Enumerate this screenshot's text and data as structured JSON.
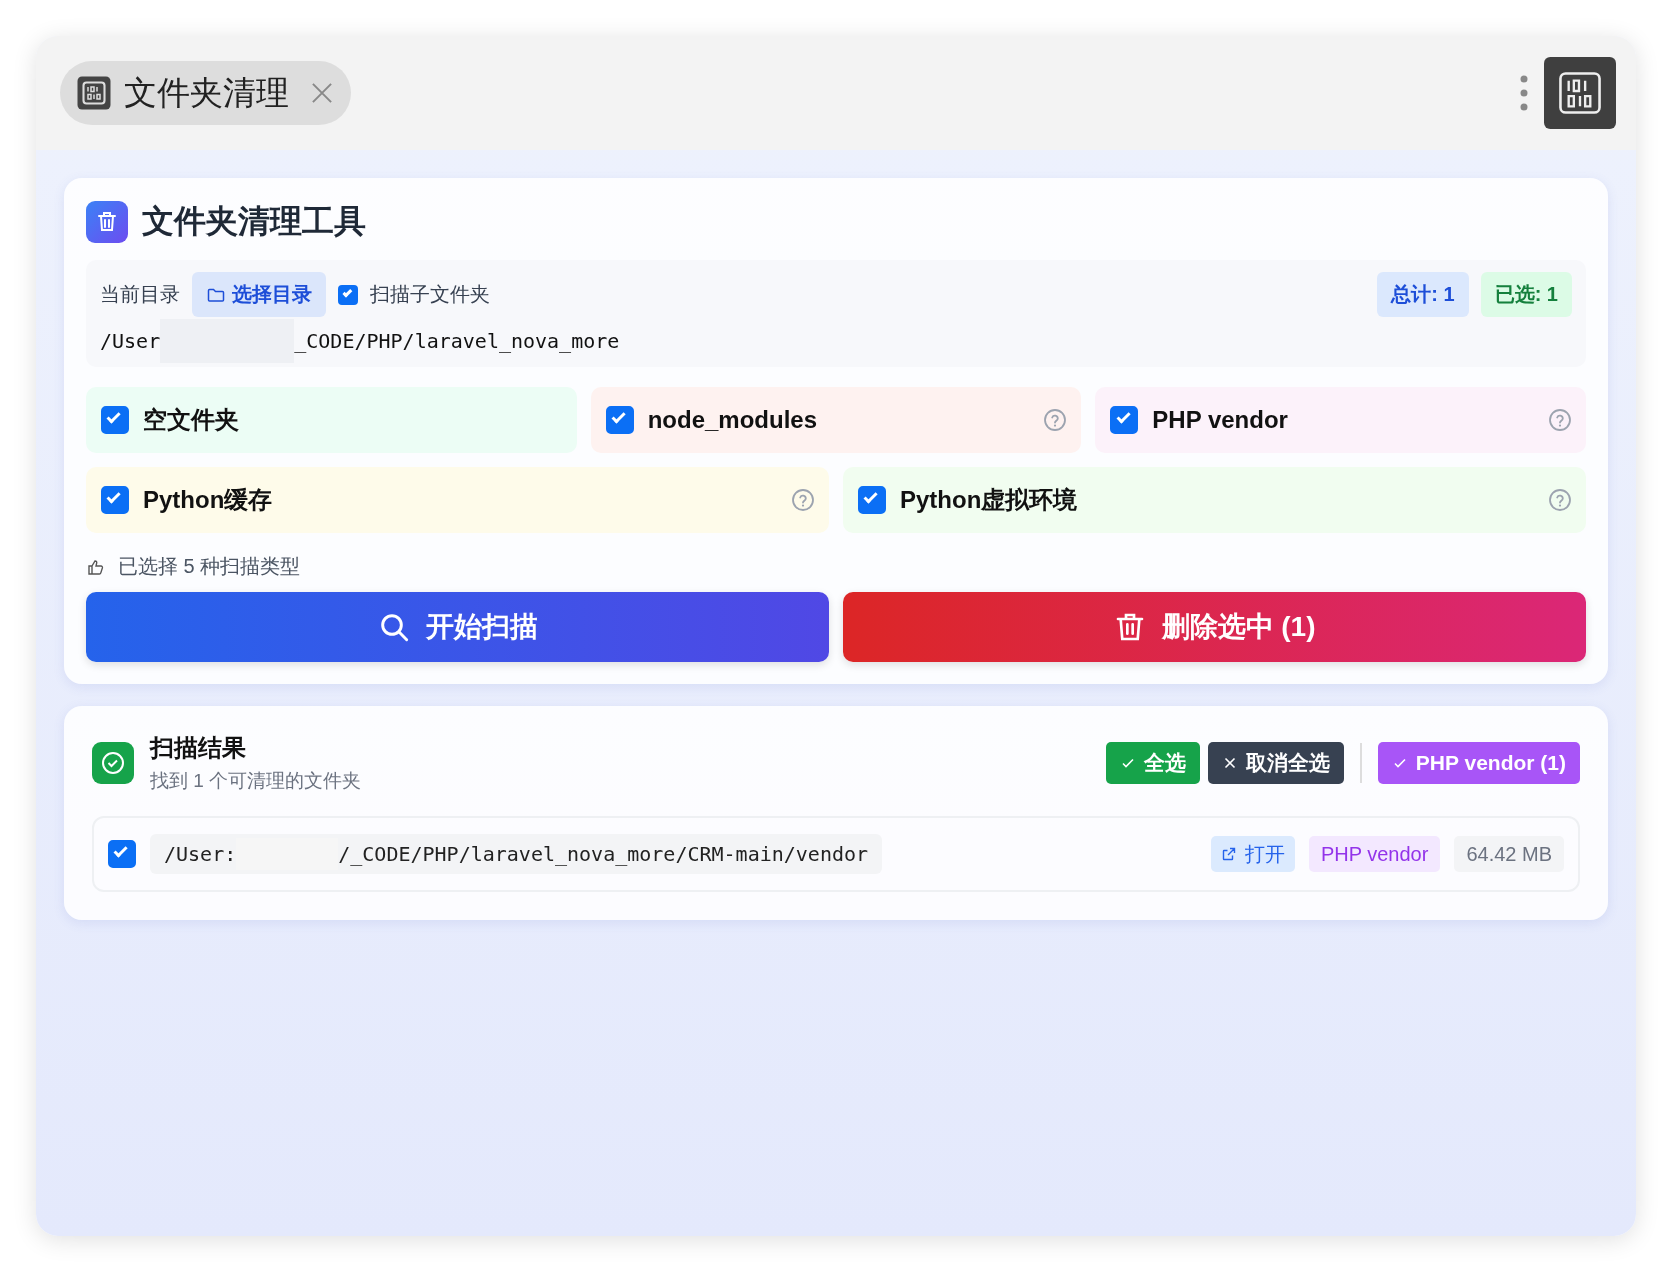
{
  "tab": {
    "title": "文件夹清理",
    "selected": true
  },
  "tool": {
    "title": "文件夹清理工具"
  },
  "directory": {
    "label": "当前目录",
    "choose_button": "选择目录",
    "scan_subfolders": {
      "label": "扫描子文件夹",
      "checked": true
    },
    "path_start": "/User",
    "path_end": "_CODE/PHP/laravel_nova_more",
    "redacted": true,
    "total": "总计: 1",
    "selected_count": "已选: 1"
  },
  "types": [
    {
      "label": "空文件夹",
      "checked": true,
      "help": false,
      "color": "#ecfdf5"
    },
    {
      "label": "node_modules",
      "checked": true,
      "help": true,
      "color": "#fef2f0"
    },
    {
      "label": "PHP vendor",
      "checked": true,
      "help": true,
      "color": "#fcf2fa"
    },
    {
      "label": "Python缓存",
      "checked": true,
      "help": true,
      "color": "#fefbea"
    },
    {
      "label": "Python虚拟环境",
      "checked": true,
      "help": true,
      "color": "#f1fdf0"
    }
  ],
  "types_summary": "已选择 5 种扫描类型",
  "scan_button": "开始扫描",
  "delete_button": "删除选中 (1)",
  "results": {
    "title": "扫描结果",
    "subtitle": "找到 1 个可清理的文件夹",
    "select_all": "全选",
    "deselect_all": "取消全选",
    "filter": "PHP vendor (1)",
    "rows": [
      {
        "checked": true,
        "path_start": "/User:",
        "path_end": "/_CODE/PHP/laravel_nova_more/CRM-main/vendor",
        "redacted": true,
        "open": "打开",
        "type": "PHP vendor",
        "size": "64.42 MB"
      }
    ]
  }
}
